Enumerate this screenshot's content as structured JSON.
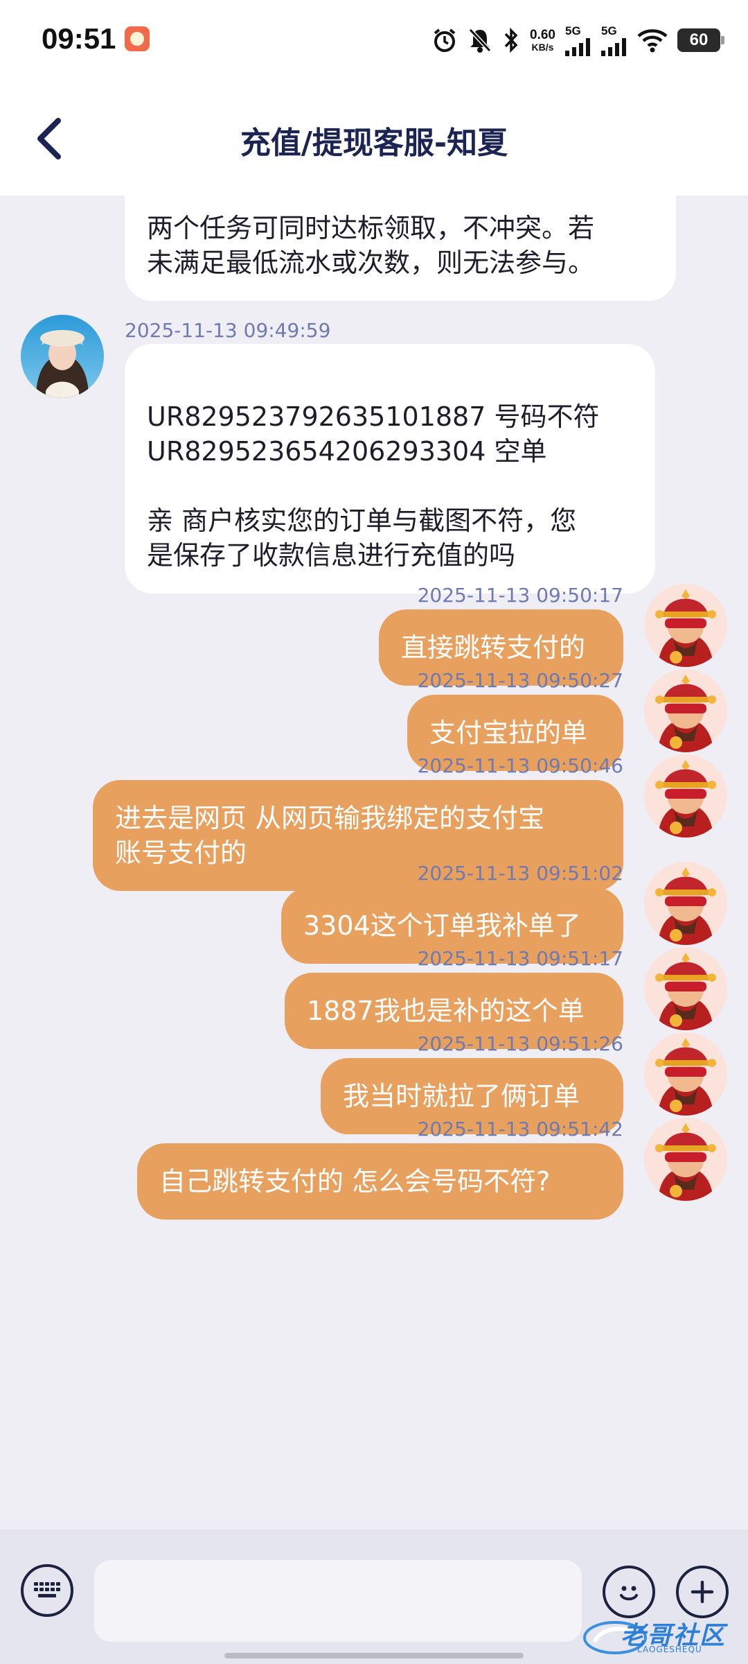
{
  "status_bar": {
    "time": "09:51",
    "net_speed_value": "0.60",
    "net_speed_unit": "KB/s",
    "signal1_label": "5G",
    "signal2_label": "5G",
    "battery": "60"
  },
  "header": {
    "title": "充值/提现客服-知夏"
  },
  "messages": [
    {
      "side": "in",
      "text": "两个任务可同时达标领取，不冲突。若\n未满足最低流水或次数，则无法参与。"
    },
    {
      "side": "in",
      "timestamp": "2025-11-13 09:49:59",
      "text": "UR829523792635101887 号码不符\nUR829523654206293304   空单\n\n亲 商户核实您的订单与截图不符，您\n是保存了收款信息进行充值的吗"
    },
    {
      "side": "out",
      "timestamp": "2025-11-13 09:50:17",
      "text": "直接跳转支付的"
    },
    {
      "side": "out",
      "timestamp": "2025-11-13 09:50:27",
      "text": "支付宝拉的单"
    },
    {
      "side": "out",
      "timestamp": "2025-11-13 09:50:46",
      "text": "进去是网页 从网页输我绑定的支付宝\n账号支付的"
    },
    {
      "side": "out",
      "timestamp": "2025-11-13 09:51:02",
      "text": "3304这个订单我补单了"
    },
    {
      "side": "out",
      "timestamp": "2025-11-13 09:51:17",
      "text": "1887我也是补的这个单"
    },
    {
      "side": "out",
      "timestamp": "2025-11-13 09:51:26",
      "text": "我当时就拉了俩订单"
    },
    {
      "side": "out",
      "timestamp": "2025-11-13 09:51:42",
      "text": "自己跳转支付的 怎么会号码不符?"
    }
  ],
  "input": {
    "placeholder": ""
  },
  "watermark": {
    "text": "老哥社区",
    "sub": "LAOGESHEQU"
  },
  "colors": {
    "outgoing_bubble": "#e8a05e",
    "incoming_bubble": "#ffffff",
    "chat_background": "#eeeef4",
    "timestamp": "#6f7ab0",
    "title": "#1b2452"
  },
  "icons": {
    "back": "chevron-left-icon",
    "keyboard": "keyboard-icon",
    "emoji": "emoji-icon",
    "plus": "plus-icon"
  }
}
